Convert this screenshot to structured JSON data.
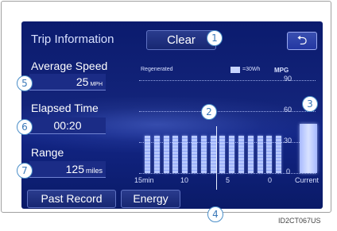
{
  "header": {
    "title": "Trip Information",
    "clear_label": "Clear",
    "back_icon": "back-arrow-icon"
  },
  "average_speed": {
    "label": "Average Speed",
    "value": "25",
    "unit": "MPH"
  },
  "elapsed_time": {
    "label": "Elapsed Time",
    "value": "00:20"
  },
  "range": {
    "label": "Range",
    "value": "125",
    "unit": "miles"
  },
  "buttons": {
    "past_record": "Past Record",
    "energy": "Energy"
  },
  "chart_header": {
    "regenerated_label": "Regenerated",
    "legend_text": "=30Wh",
    "unit": "MPG"
  },
  "chart_data": {
    "type": "bar",
    "title": "",
    "xlabel": "",
    "ylabel": "MPG",
    "x_ticks": [
      "15min",
      "10",
      "5",
      "0"
    ],
    "y_ticks": [
      "90",
      "60",
      "30",
      "0"
    ],
    "ylim": [
      0,
      90
    ],
    "values": [
      36,
      36,
      36,
      36,
      36,
      36,
      36,
      36,
      36,
      36,
      36,
      36,
      36,
      36,
      36
    ],
    "current": {
      "label": "Current",
      "value": 48
    },
    "grid": true
  },
  "markers": [
    "1",
    "2",
    "3",
    "4",
    "5",
    "6",
    "7"
  ],
  "image_id": "ID2CT067US",
  "colors": {
    "screen_bg": "#13247a",
    "bar": "#b7c8ff",
    "accent": "#4a8ec8"
  }
}
